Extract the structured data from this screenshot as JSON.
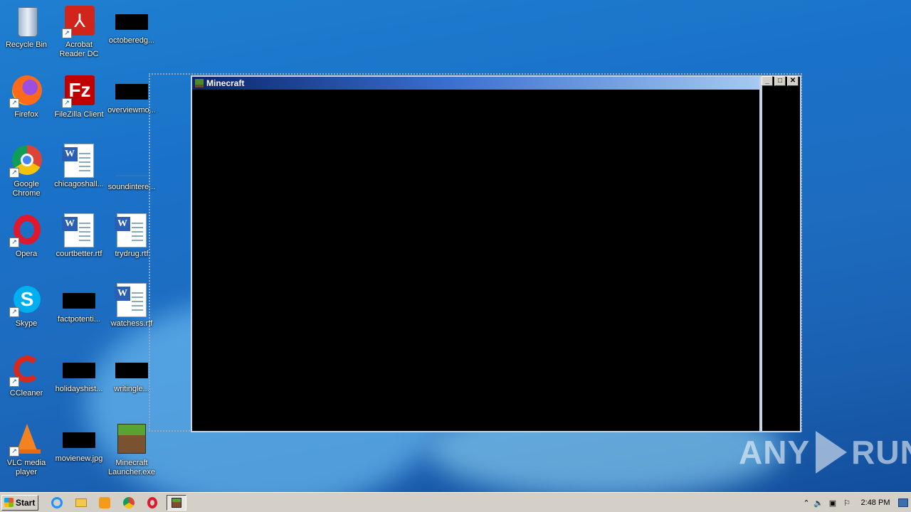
{
  "desktop": {
    "icons": [
      {
        "label": "Recycle Bin"
      },
      {
        "label": "Acrobat Reader DC"
      },
      {
        "label": "octoberedg..."
      },
      {
        "label": "Firefox"
      },
      {
        "label": "FileZilla Client"
      },
      {
        "label": "overviewmo..."
      },
      {
        "label": "Google Chrome"
      },
      {
        "label": "chicagoshall..."
      },
      {
        "label": "soundintere..."
      },
      {
        "label": "Opera"
      },
      {
        "label": "courtbetter.rtf"
      },
      {
        "label": "trydrug.rtf"
      },
      {
        "label": "Skype"
      },
      {
        "label": "factpotenti..."
      },
      {
        "label": "watchess.rtf"
      },
      {
        "label": "CCleaner"
      },
      {
        "label": "holidayshist..."
      },
      {
        "label": "writingle..."
      },
      {
        "label": "VLC media player"
      },
      {
        "label": "movienew.jpg"
      },
      {
        "label": "Minecraft Launcher.exe"
      }
    ]
  },
  "window": {
    "title": "Minecraft"
  },
  "caption_buttons": {
    "minimize": "_",
    "maximize": "□",
    "close": "✕"
  },
  "watermark": {
    "left": "ANY",
    "right": "RUN"
  },
  "taskbar": {
    "start_label": "Start",
    "clock": "2:48 PM",
    "pinned": [
      "internet-explorer-icon",
      "explorer-folder-icon",
      "media-player-icon",
      "chrome-icon",
      "opera-icon",
      "minecraft-icon"
    ]
  },
  "colors": {
    "desktop_blue": "#1a72c8",
    "title_dark": "#0b246a",
    "taskbar": "#d4d0c8"
  }
}
